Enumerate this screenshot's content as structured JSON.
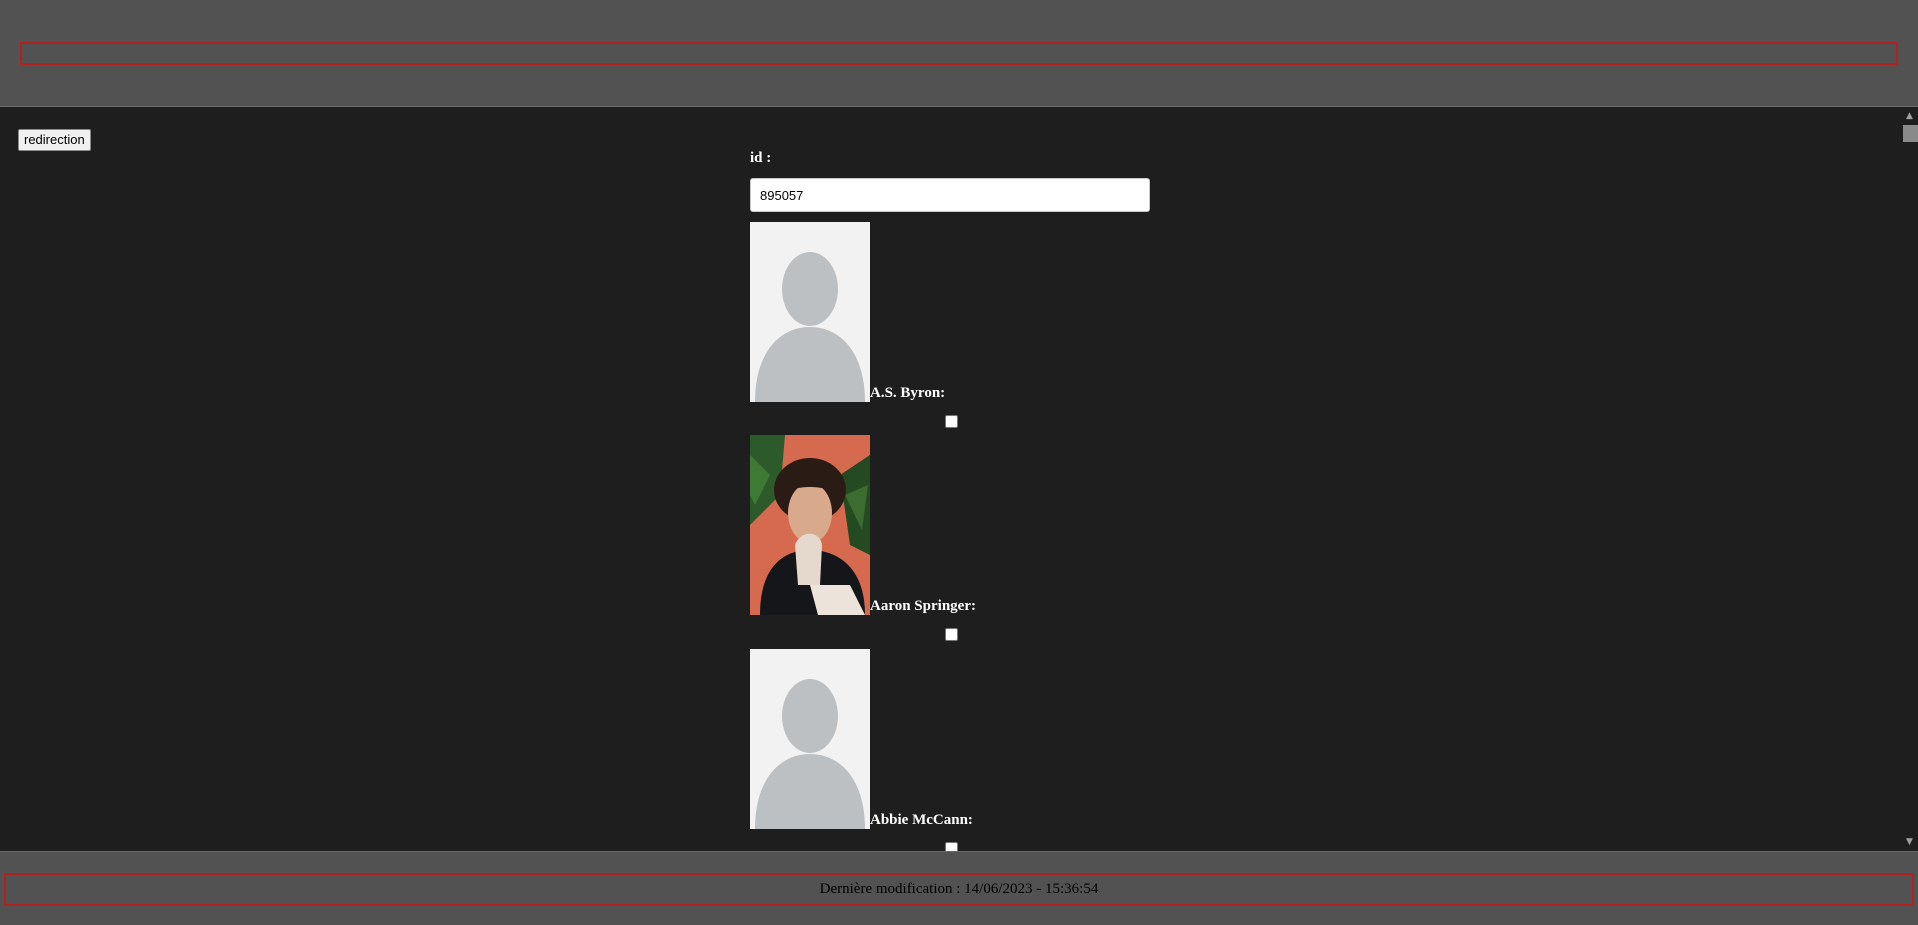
{
  "toolbar": {
    "redirect_label": "redirection"
  },
  "form": {
    "id_label": "id :",
    "id_value": "895057"
  },
  "people": [
    {
      "name": "A.S. Byron:",
      "photo": "placeholder-avatar",
      "checked": false
    },
    {
      "name": "Aaron Springer:",
      "photo": "portrait-photo",
      "checked": false
    },
    {
      "name": "Abbie McCann:",
      "photo": "placeholder-avatar",
      "checked": false
    }
  ],
  "footer": {
    "last_modified": "Dernière modification : 14/06/2023 - 15:36:54"
  },
  "colors": {
    "header_bg": "#525252",
    "content_bg": "#1e1e1e",
    "outline_red": "#b32020"
  }
}
